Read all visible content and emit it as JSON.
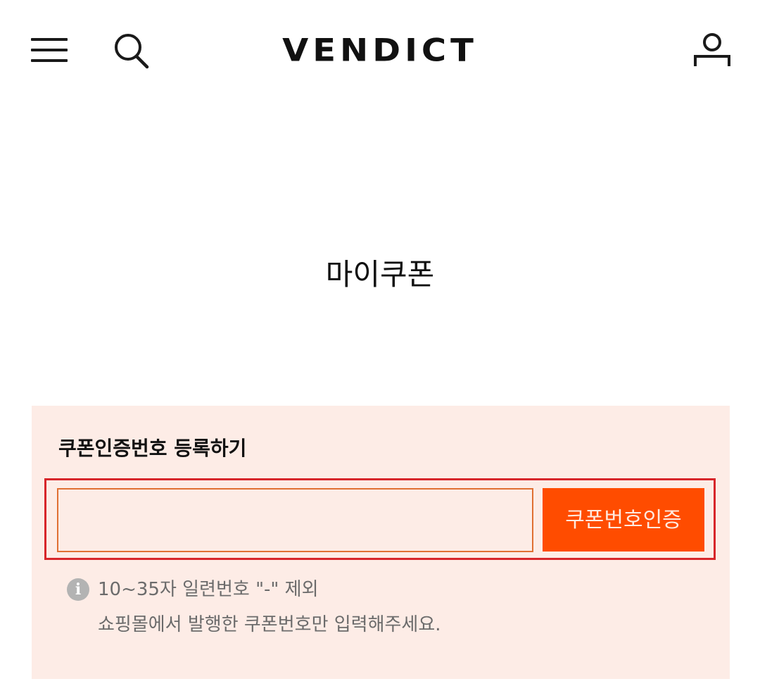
{
  "header": {
    "brand": "VENDICT",
    "icons": {
      "menu": "hamburger-icon",
      "search": "search-icon",
      "account": "user-icon"
    }
  },
  "page": {
    "title": "마이쿠폰"
  },
  "coupon_register": {
    "heading": "쿠폰인증번호 등록하기",
    "input_value": "",
    "verify_button": "쿠폰번호인증",
    "help_line1": "10~35자 일련번호 \"-\" 제외",
    "help_line2": "쇼핑몰에서 발행한 쿠폰번호만 입력해주세요.",
    "info_icon": "info-icon"
  },
  "colors": {
    "panel_bg": "#fdece6",
    "accent": "#ff4c00",
    "input_border": "#e07033",
    "highlight": "#d7262b"
  }
}
